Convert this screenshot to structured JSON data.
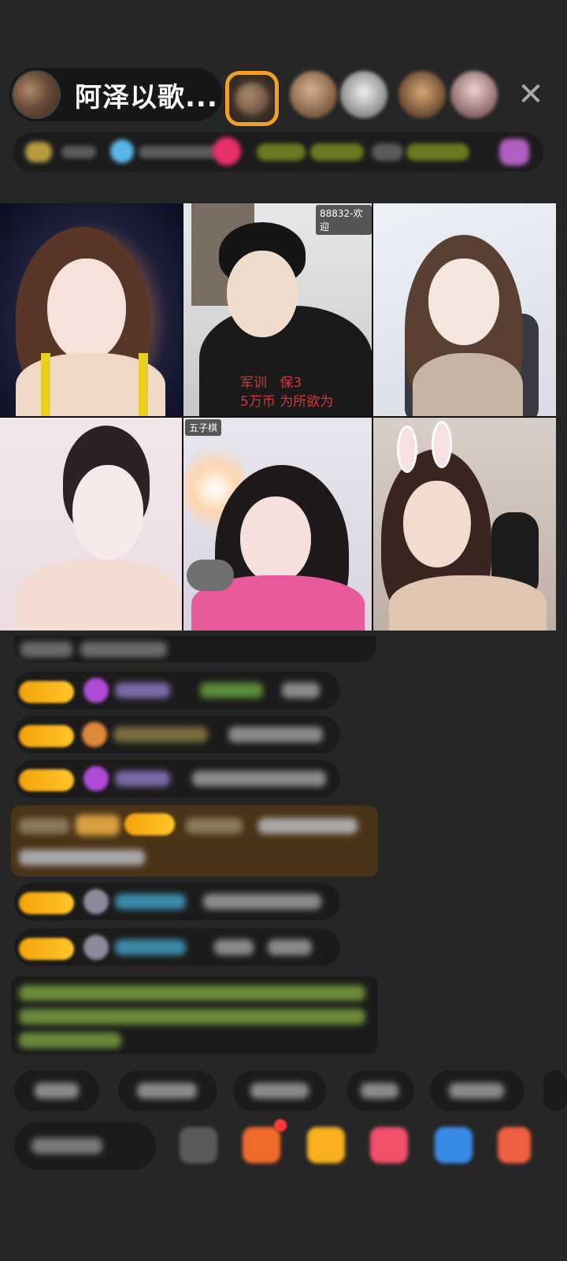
{
  "header": {
    "host_name": "阿泽以歌...",
    "close_glyph": "✕"
  },
  "grid": {
    "tiles": [
      {
        "tag": ""
      },
      {
        "tag": "88832-欢迎",
        "overlay": "军训   保3\n5万币 为所欲为"
      },
      {
        "tag": ""
      },
      {
        "tag": ""
      },
      {
        "tag": "五子棋"
      },
      {
        "tag": ""
      }
    ]
  },
  "colors": {
    "background": "#262626",
    "pill": "#1b1b1b",
    "level_badge": "#f5a20a",
    "gift_banner": "#4a3418",
    "overlay_red": "#e0303a",
    "crown_border": "#f0a028"
  },
  "icons": [
    "host-avatar",
    "close-icon",
    "gem-icon",
    "gift-icon",
    "red-packet-icon",
    "game-icon",
    "share-icon",
    "more-icon"
  ]
}
